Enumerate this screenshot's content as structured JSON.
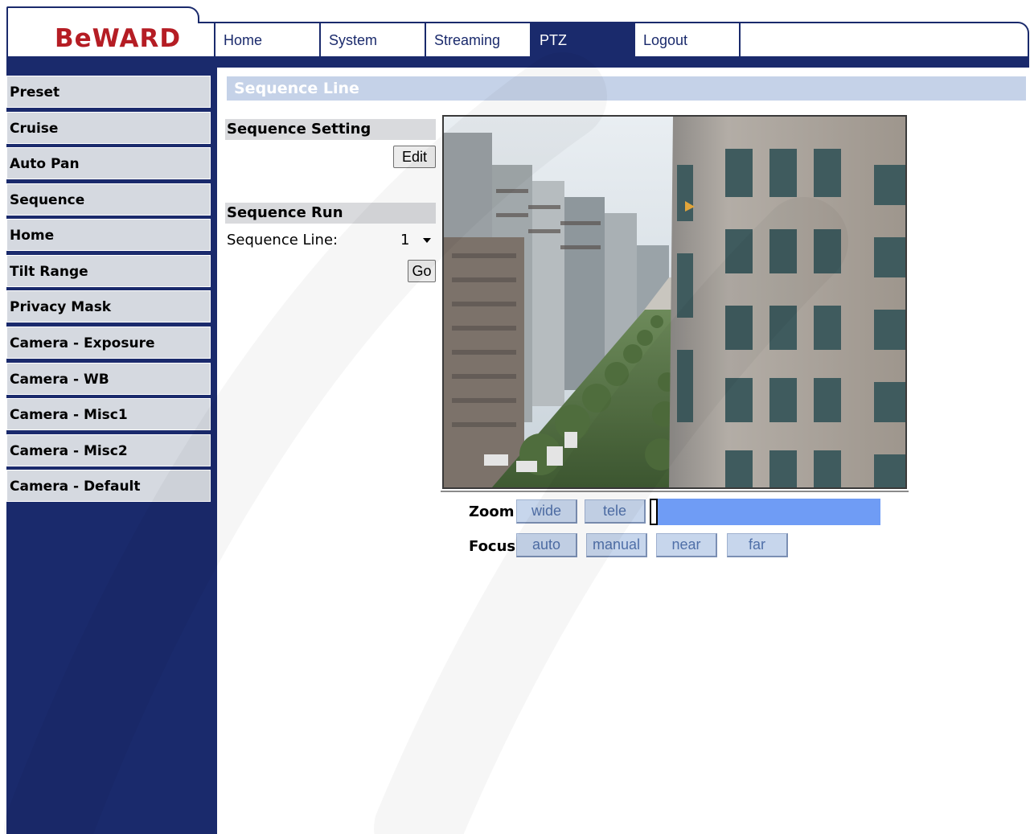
{
  "brand": {
    "logo_text": "BeWARD",
    "accent": "#b51d24",
    "nav_color": "#1a2a6c"
  },
  "nav": {
    "tabs": [
      {
        "label": "Home"
      },
      {
        "label": "System"
      },
      {
        "label": "Streaming"
      },
      {
        "label": "PTZ",
        "active": true
      },
      {
        "label": "Logout"
      }
    ]
  },
  "sidebar": {
    "items": [
      {
        "label": "Preset"
      },
      {
        "label": "Cruise"
      },
      {
        "label": "Auto Pan"
      },
      {
        "label": "Sequence"
      },
      {
        "label": "Home"
      },
      {
        "label": "Tilt Range"
      },
      {
        "label": "Privacy Mask"
      },
      {
        "label": "Camera - Exposure"
      },
      {
        "label": "Camera - WB"
      },
      {
        "label": "Camera - Misc1"
      },
      {
        "label": "Camera - Misc2"
      },
      {
        "label": "Camera - Default"
      }
    ]
  },
  "main": {
    "title": "Sequence Line",
    "sequence_setting": {
      "heading": "Sequence Setting",
      "edit_label": "Edit"
    },
    "sequence_run": {
      "heading": "Sequence Run",
      "line_label": "Sequence Line:",
      "line_value": "1",
      "go_label": "Go"
    },
    "ptz": {
      "zoom_label": "Zoom",
      "wide_label": "wide",
      "tele_label": "tele",
      "zoom_level": 0,
      "focus_label": "Focus",
      "auto_label": "auto",
      "manual_label": "manual",
      "near_label": "near",
      "far_label": "far"
    }
  }
}
